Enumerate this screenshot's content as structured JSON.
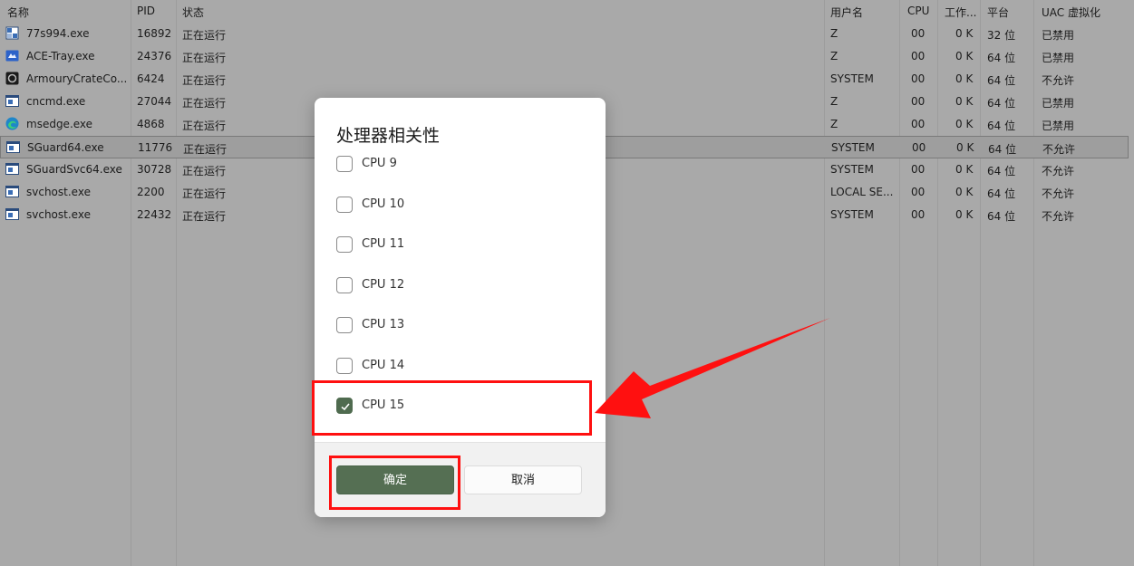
{
  "table": {
    "columns": {
      "name": "名称",
      "pid": "PID",
      "status": "状态",
      "user": "用户名",
      "cpu": "CPU",
      "memory": "工作...",
      "platform": "平台",
      "uac": "UAC 虚拟化"
    },
    "rows": [
      {
        "icon": "app-generic-icon",
        "name": "77s994.exe",
        "pid": "16892",
        "status": "正在运行",
        "user": "Z",
        "cpu": "00",
        "memory": "0 K",
        "platform": "32 位",
        "uac": "已禁用",
        "selected": false
      },
      {
        "icon": "ace-tray-icon",
        "name": "ACE-Tray.exe",
        "pid": "24376",
        "status": "正在运行",
        "user": "Z",
        "cpu": "00",
        "memory": "0 K",
        "platform": "64 位",
        "uac": "已禁用",
        "selected": false
      },
      {
        "icon": "armoury-crate-icon",
        "name": "ArmouryCrateCo...",
        "pid": "6424",
        "status": "正在运行",
        "user": "SYSTEM",
        "cpu": "00",
        "memory": "0 K",
        "platform": "64 位",
        "uac": "不允许",
        "selected": false
      },
      {
        "icon": "window-app-icon",
        "name": "cncmd.exe",
        "pid": "27044",
        "status": "正在运行",
        "user": "Z",
        "cpu": "00",
        "memory": "0 K",
        "platform": "64 位",
        "uac": "已禁用",
        "selected": false
      },
      {
        "icon": "edge-browser-icon",
        "name": "msedge.exe",
        "pid": "4868",
        "status": "正在运行",
        "user": "Z",
        "cpu": "00",
        "memory": "0 K",
        "platform": "64 位",
        "uac": "已禁用",
        "selected": false
      },
      {
        "icon": "window-app-icon",
        "name": "SGuard64.exe",
        "pid": "11776",
        "status": "正在运行",
        "user": "SYSTEM",
        "cpu": "00",
        "memory": "0 K",
        "platform": "64 位",
        "uac": "不允许",
        "selected": true
      },
      {
        "icon": "window-app-icon",
        "name": "SGuardSvc64.exe",
        "pid": "30728",
        "status": "正在运行",
        "user": "SYSTEM",
        "cpu": "00",
        "memory": "0 K",
        "platform": "64 位",
        "uac": "不允许",
        "selected": false
      },
      {
        "icon": "window-app-icon",
        "name": "svchost.exe",
        "pid": "2200",
        "status": "正在运行",
        "user": "LOCAL SE...",
        "cpu": "00",
        "memory": "0 K",
        "platform": "64 位",
        "uac": "不允许",
        "selected": false
      },
      {
        "icon": "window-app-icon",
        "name": "svchost.exe",
        "pid": "22432",
        "status": "正在运行",
        "user": "SYSTEM",
        "cpu": "00",
        "memory": "0 K",
        "platform": "64 位",
        "uac": "不允许",
        "selected": false
      }
    ]
  },
  "dialog": {
    "title": "处理器相关性",
    "checkboxes": [
      {
        "label": "CPU 9",
        "checked": false
      },
      {
        "label": "CPU 10",
        "checked": false
      },
      {
        "label": "CPU 11",
        "checked": false
      },
      {
        "label": "CPU 12",
        "checked": false
      },
      {
        "label": "CPU 13",
        "checked": false
      },
      {
        "label": "CPU 14",
        "checked": false
      },
      {
        "label": "CPU 15",
        "checked": true
      }
    ],
    "ok_label": "确定",
    "cancel_label": "取消"
  },
  "colors": {
    "accent": "#556f53",
    "annotation": "#ff1010",
    "overlay": "#a9a9a9"
  }
}
